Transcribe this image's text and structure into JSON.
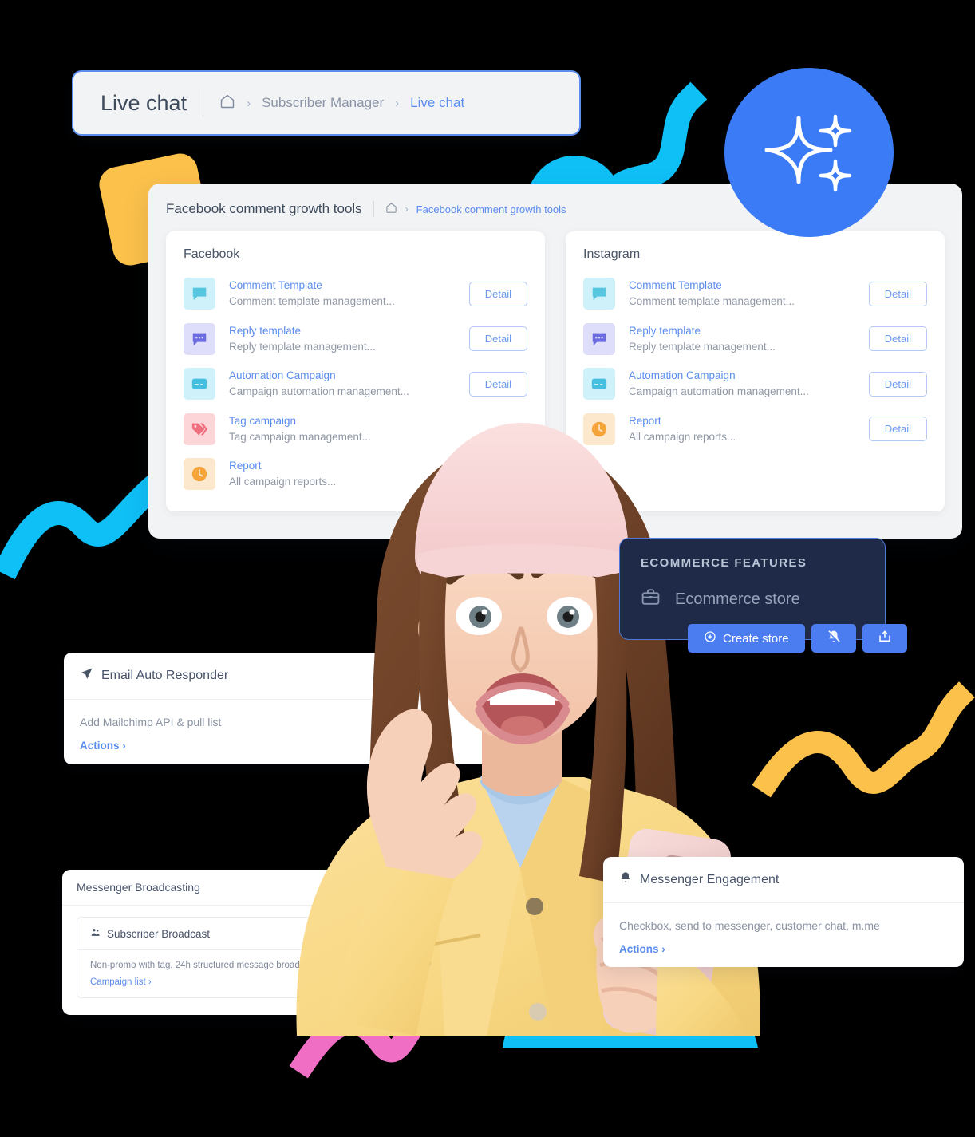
{
  "topbar": {
    "title": "Live chat",
    "home_icon": "home-icon",
    "sep": "›",
    "crumb1": "Subscriber Manager",
    "crumb2": "Live chat"
  },
  "main_panel": {
    "title": "Facebook comment growth tools",
    "home_icon": "home-icon",
    "sep": "›",
    "crumb": "Facebook comment growth tools",
    "cards": [
      {
        "heading": "Facebook",
        "items": [
          {
            "icon": "comment-bubble-icon",
            "icon_style": "cyan",
            "title": "Comment Template",
            "desc": "Comment template management...",
            "button": "Detail",
            "has_button": true
          },
          {
            "icon": "reply-bubble-icon",
            "icon_style": "lav",
            "title": "Reply template",
            "desc": "Reply template management...",
            "button": "Detail",
            "has_button": true
          },
          {
            "icon": "automation-card-icon",
            "icon_style": "cyan",
            "title": "Automation Campaign",
            "desc": "Campaign automation management...",
            "button": "Detail",
            "has_button": true
          },
          {
            "icon": "tag-icon",
            "icon_style": "pink",
            "title": "Tag campaign",
            "desc": "Tag campaign management...",
            "button": "Detail",
            "has_button": false
          },
          {
            "icon": "clock-icon",
            "icon_style": "amber",
            "title": "Report",
            "desc": "All campaign reports...",
            "button": "Detail",
            "has_button": false
          }
        ]
      },
      {
        "heading": "Instagram",
        "items": [
          {
            "icon": "comment-bubble-icon",
            "icon_style": "cyan",
            "title": "Comment Template",
            "desc": "Comment template management...",
            "button": "Detail",
            "has_button": true
          },
          {
            "icon": "reply-bubble-icon",
            "icon_style": "lav",
            "title": "Reply template",
            "desc": "Reply template management...",
            "button": "Detail",
            "has_button": true
          },
          {
            "icon": "automation-card-icon",
            "icon_style": "cyan",
            "title": "Automation Campaign",
            "desc": "Campaign automation management...",
            "button": "Detail",
            "has_button": true
          },
          {
            "icon": "clock-icon",
            "icon_style": "amber",
            "title": "Report",
            "desc": "All campaign reports...",
            "button": "Detail",
            "has_button": true
          }
        ]
      }
    ]
  },
  "ecommerce": {
    "title": "ECOMMERCE FEATURES",
    "store_icon": "briefcase-icon",
    "store_label": "Ecommerce store",
    "create_label": "Create store",
    "create_icon": "plus-circle-icon",
    "mute_icon": "bell-off-icon",
    "export_icon": "export-box-icon"
  },
  "email_card": {
    "icon": "paper-plane-icon",
    "title": "Email Auto Responder",
    "desc": "Add Mailchimp API & pull list",
    "link": "Actions ›"
  },
  "engagement_card": {
    "icon": "bell-icon",
    "title": "Messenger Engagement",
    "desc": "Checkbox, send to messenger, customer chat, m.me",
    "link": "Actions ›"
  },
  "broadcast_card": {
    "title": "Messenger Broadcasting",
    "inner_icon": "people-icon",
    "inner_title": "Subscriber Broadcast",
    "inner_desc": "Non-promo with tag, 24h structured message broadcast to messenger bot subscribers",
    "inner_link": "Campaign list ›"
  },
  "badge": {
    "icon": "sparkle-icon"
  },
  "colors": {
    "accent_blue": "#5B8DEF",
    "badge_blue": "#3B7BF6",
    "dark_card": "#1E2A47",
    "cyan": "#0FC0F7",
    "yellow": "#FBC14B",
    "pink": "#F06FC4",
    "panel_bg": "#F2F3F5"
  }
}
